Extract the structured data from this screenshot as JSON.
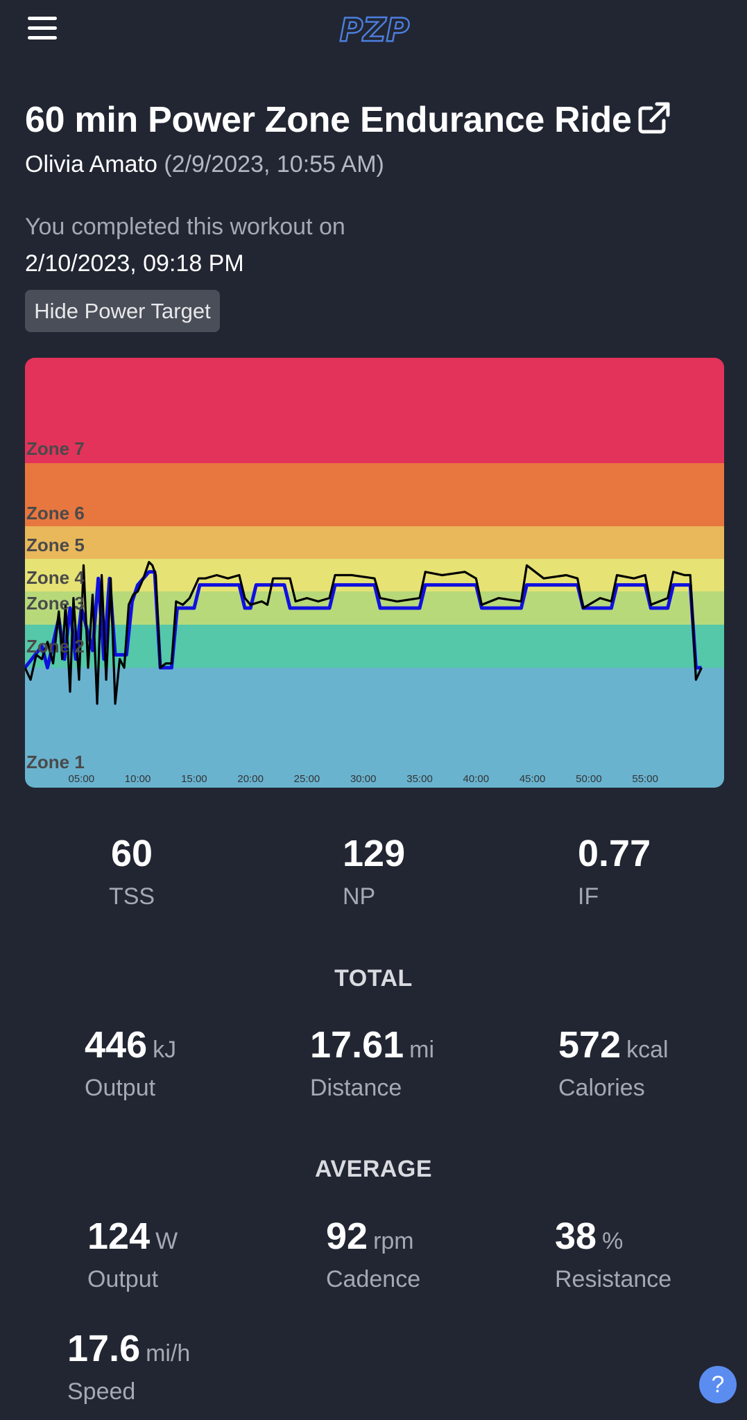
{
  "header": {
    "logo_text": "PZP",
    "menu_icon": "hamburger-menu-icon"
  },
  "workout": {
    "title": "60 min Power Zone Endurance Ride",
    "instructor": "Olivia Amato",
    "aired": "(2/9/2023, 10:55 AM)",
    "completed_label": "You completed this workout on",
    "completed_date": "2/10/2023, 09:18 PM"
  },
  "hide_button": "Hide Power Target",
  "chart_data": {
    "type": "line",
    "zones": [
      "Zone 1",
      "Zone 2",
      "Zone 3",
      "Zone 4",
      "Zone 5",
      "Zone 6",
      "Zone 7"
    ],
    "zone_colors": [
      "#69b3cf",
      "#54c8a8",
      "#b7d97a",
      "#e6e274",
      "#e9b85a",
      "#e8773f",
      "#e3335b"
    ],
    "x_ticks": [
      "05:00",
      "10:00",
      "15:00",
      "20:00",
      "25:00",
      "30:00",
      "35:00",
      "40:00",
      "45:00",
      "50:00",
      "55:00"
    ],
    "x_range_min": [
      0,
      62
    ],
    "series": [
      {
        "color": "#1010e0",
        "points": [
          [
            0,
            1
          ],
          [
            1.5,
            1.5
          ],
          [
            2,
            1
          ],
          [
            3,
            2.2
          ],
          [
            3.5,
            1.2
          ],
          [
            4,
            2.5
          ],
          [
            4.5,
            1.2
          ],
          [
            5,
            2.5
          ],
          [
            6,
            1.4
          ],
          [
            6.5,
            3.4
          ],
          [
            7,
            1.2
          ],
          [
            7.5,
            3.4
          ],
          [
            8,
            1.3
          ],
          [
            9,
            1.3
          ],
          [
            9.5,
            2.7
          ],
          [
            10,
            3.2
          ],
          [
            11,
            3.6
          ],
          [
            11.5,
            3.6
          ],
          [
            12,
            1
          ],
          [
            13,
            1
          ],
          [
            13.5,
            2.5
          ],
          [
            15,
            2.5
          ],
          [
            15.5,
            3.2
          ],
          [
            19,
            3.2
          ],
          [
            19.5,
            2.5
          ],
          [
            20,
            2.5
          ],
          [
            20.5,
            3.2
          ],
          [
            23,
            3.2
          ],
          [
            23.5,
            2.5
          ],
          [
            27,
            2.5
          ],
          [
            27.5,
            3.2
          ],
          [
            31,
            3.2
          ],
          [
            31.5,
            2.5
          ],
          [
            35,
            2.5
          ],
          [
            35.5,
            3.2
          ],
          [
            40,
            3.2
          ],
          [
            40.5,
            2.5
          ],
          [
            44,
            2.5
          ],
          [
            44.5,
            3.2
          ],
          [
            49,
            3.2
          ],
          [
            49.5,
            2.5
          ],
          [
            52,
            2.5
          ],
          [
            52.5,
            3.2
          ],
          [
            55,
            3.2
          ],
          [
            55.5,
            2.5
          ],
          [
            57,
            2.5
          ],
          [
            57.5,
            3.2
          ],
          [
            59,
            3.2
          ],
          [
            59.5,
            1
          ],
          [
            60,
            1
          ]
        ]
      },
      {
        "color": "#000000",
        "points": [
          [
            0,
            1
          ],
          [
            0.5,
            0.9
          ],
          [
            1,
            1.3
          ],
          [
            1.5,
            1.2
          ],
          [
            2,
            1.6
          ],
          [
            2.5,
            1.1
          ],
          [
            3,
            2.4
          ],
          [
            3.3,
            1.2
          ],
          [
            3.6,
            2.6
          ],
          [
            4,
            0.8
          ],
          [
            4.3,
            2.8
          ],
          [
            4.8,
            0.9
          ],
          [
            5.2,
            3.8
          ],
          [
            5.6,
            1.0
          ],
          [
            6.0,
            2.9
          ],
          [
            6.4,
            0.7
          ],
          [
            6.8,
            3.5
          ],
          [
            7.2,
            0.9
          ],
          [
            7.6,
            3.4
          ],
          [
            8,
            0.7
          ],
          [
            8.4,
            1.2
          ],
          [
            8.8,
            1.0
          ],
          [
            9.2,
            2.6
          ],
          [
            9.6,
            2.9
          ],
          [
            10,
            3.0
          ],
          [
            10.5,
            3.4
          ],
          [
            11,
            3.9
          ],
          [
            11.3,
            3.8
          ],
          [
            11.6,
            3.5
          ],
          [
            12,
            1.0
          ],
          [
            12.5,
            1.1
          ],
          [
            13,
            1.1
          ],
          [
            13.4,
            2.7
          ],
          [
            14,
            2.6
          ],
          [
            14.6,
            2.8
          ],
          [
            15.4,
            3.4
          ],
          [
            16,
            3.4
          ],
          [
            17,
            3.5
          ],
          [
            18,
            3.4
          ],
          [
            19,
            3.5
          ],
          [
            19.5,
            2.8
          ],
          [
            20,
            2.6
          ],
          [
            21,
            2.7
          ],
          [
            21.5,
            2.6
          ],
          [
            22,
            3.4
          ],
          [
            23,
            3.4
          ],
          [
            23.5,
            3.4
          ],
          [
            24,
            2.7
          ],
          [
            25,
            2.8
          ],
          [
            26,
            2.7
          ],
          [
            27,
            2.8
          ],
          [
            27.5,
            3.5
          ],
          [
            29,
            3.5
          ],
          [
            31,
            3.4
          ],
          [
            31.5,
            2.8
          ],
          [
            33,
            2.7
          ],
          [
            35,
            2.8
          ],
          [
            35.5,
            3.6
          ],
          [
            37,
            3.5
          ],
          [
            39,
            3.6
          ],
          [
            40,
            3.4
          ],
          [
            40.5,
            2.6
          ],
          [
            42,
            2.8
          ],
          [
            44,
            2.7
          ],
          [
            44.5,
            3.8
          ],
          [
            46,
            3.4
          ],
          [
            48,
            3.5
          ],
          [
            49,
            3.4
          ],
          [
            49.5,
            2.5
          ],
          [
            51,
            2.8
          ],
          [
            52,
            2.7
          ],
          [
            52.5,
            3.5
          ],
          [
            54,
            3.4
          ],
          [
            55,
            3.5
          ],
          [
            55.5,
            2.6
          ],
          [
            57,
            2.8
          ],
          [
            57.5,
            3.6
          ],
          [
            58.5,
            3.5
          ],
          [
            59,
            3.5
          ],
          [
            59.5,
            0.9
          ],
          [
            60,
            1.0
          ]
        ]
      }
    ],
    "y_range_zone": [
      0,
      7
    ]
  },
  "summary": [
    {
      "value": "60",
      "label": "TSS"
    },
    {
      "value": "129",
      "label": "NP"
    },
    {
      "value": "0.77",
      "label": "IF"
    }
  ],
  "total": {
    "heading": "TOTAL",
    "items": [
      {
        "value": "446",
        "unit": "kJ",
        "label": "Output"
      },
      {
        "value": "17.61",
        "unit": "mi",
        "label": "Distance"
      },
      {
        "value": "572",
        "unit": "kcal",
        "label": "Calories"
      }
    ]
  },
  "average": {
    "heading": "AVERAGE",
    "items": [
      {
        "value": "124",
        "unit": "W",
        "label": "Output"
      },
      {
        "value": "92",
        "unit": "rpm",
        "label": "Cadence"
      },
      {
        "value": "38",
        "unit": "%",
        "label": "Resistance"
      },
      {
        "value": "17.6",
        "unit": "mi/h",
        "label": "Speed"
      }
    ]
  },
  "help_label": "?"
}
